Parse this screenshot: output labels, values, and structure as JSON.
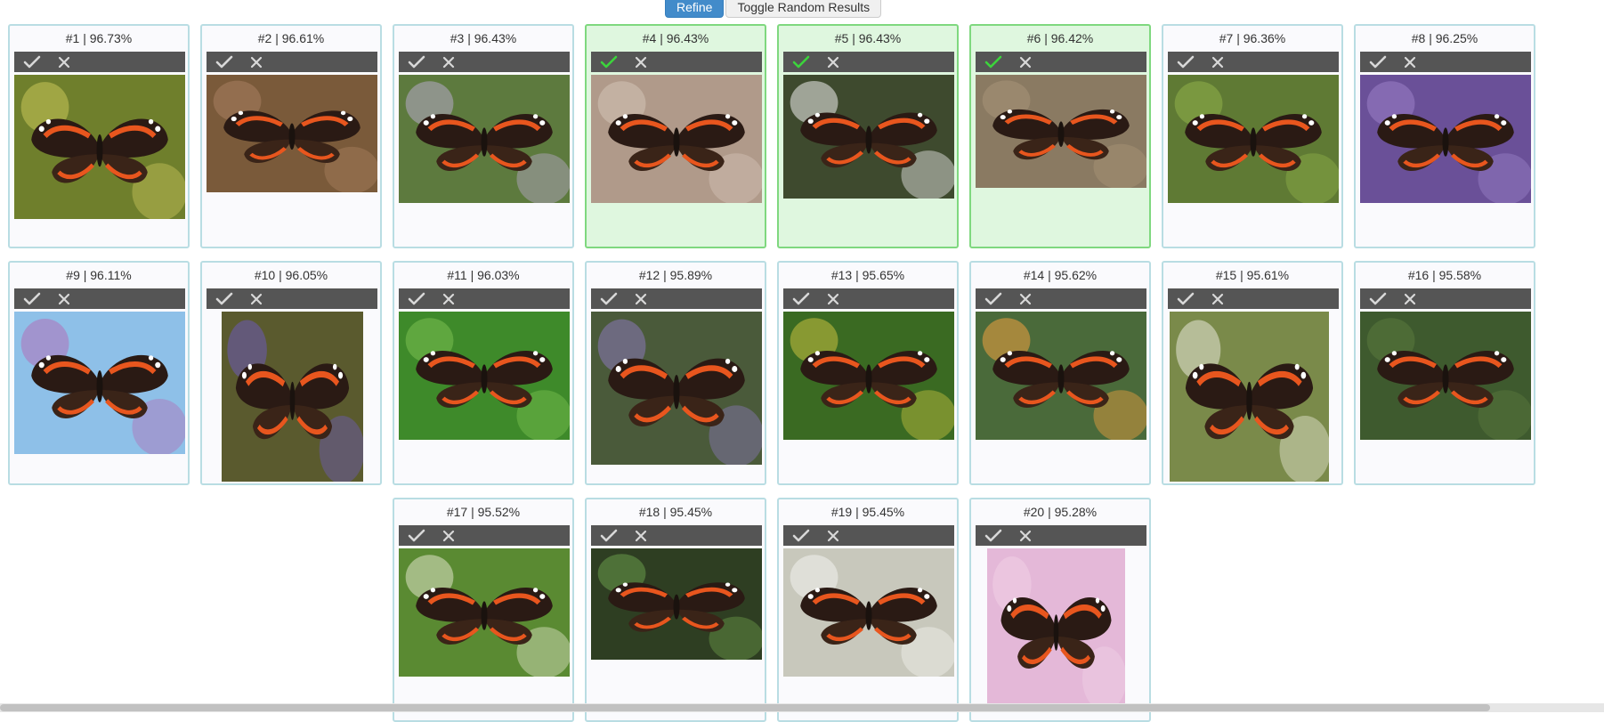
{
  "toolbar": {
    "refine_label": "Refine",
    "toggle_label": "Toggle Random Results"
  },
  "colors": {
    "accent": "#428bca",
    "card_border": "#b9dde3",
    "selected_bg": "#dff7df",
    "selected_border": "#7fd87f",
    "check_active": "#3cd43c",
    "toolbar_bg": "#555555"
  },
  "results": [
    {
      "label": "#1 | 96.73%",
      "selected": false,
      "bg": "#6f7f2c",
      "accent": "#c8c65a"
    },
    {
      "label": "#2 | 96.61%",
      "selected": false,
      "bg": "#7a5a3a",
      "accent": "#a88060"
    },
    {
      "label": "#3 | 96.43%",
      "selected": false,
      "bg": "#5d7a3e",
      "accent": "#b7a9c9"
    },
    {
      "label": "#4 | 96.43%",
      "selected": true,
      "bg": "#b09a8a",
      "accent": "#d4c4b6"
    },
    {
      "label": "#5 | 96.43%",
      "selected": true,
      "bg": "#3e4a2e",
      "accent": "#eeeeee"
    },
    {
      "label": "#6 | 96.42%",
      "selected": true,
      "bg": "#8a7a62",
      "accent": "#a89478"
    },
    {
      "label": "#7 | 96.36%",
      "selected": false,
      "bg": "#5f7a34",
      "accent": "#8fb04a"
    },
    {
      "label": "#8 | 96.25%",
      "selected": false,
      "bg": "#6a5098",
      "accent": "#9a80c8"
    },
    {
      "label": "#9 | 96.11%",
      "selected": false,
      "bg": "#8ec0e8",
      "accent": "#b070b8"
    },
    {
      "label": "#10 | 96.05%",
      "selected": false,
      "bg": "#5a5a2e",
      "accent": "#6c5ab8"
    },
    {
      "label": "#11 | 96.03%",
      "selected": false,
      "bg": "#3e8a2a",
      "accent": "#7ac050"
    },
    {
      "label": "#12 | 95.89%",
      "selected": false,
      "bg": "#4a5a3a",
      "accent": "#8a78b8"
    },
    {
      "label": "#13 | 95.65%",
      "selected": false,
      "bg": "#3a6a22",
      "accent": "#c8c040"
    },
    {
      "label": "#14 | 95.62%",
      "selected": false,
      "bg": "#4a6a3a",
      "accent": "#f0a040"
    },
    {
      "label": "#15 | 95.61%",
      "selected": false,
      "bg": "#7a8a4a",
      "accent": "#e8e8d8"
    },
    {
      "label": "#16 | 95.58%",
      "selected": false,
      "bg": "#3e5a2e",
      "accent": "#5a7a3e"
    },
    {
      "label": "#17 | 95.52%",
      "selected": false,
      "bg": "#5a8a32",
      "accent": "#e0e4c8"
    },
    {
      "label": "#18 | 95.45%",
      "selected": false,
      "bg": "#2e3e22",
      "accent": "#6a9a4a"
    },
    {
      "label": "#19 | 95.45%",
      "selected": false,
      "bg": "#c8c8bc",
      "accent": "#f2f2ee"
    },
    {
      "label": "#20 | 95.28%",
      "selected": false,
      "bg": "#e4b8d8",
      "accent": "#f0d0e6"
    }
  ]
}
